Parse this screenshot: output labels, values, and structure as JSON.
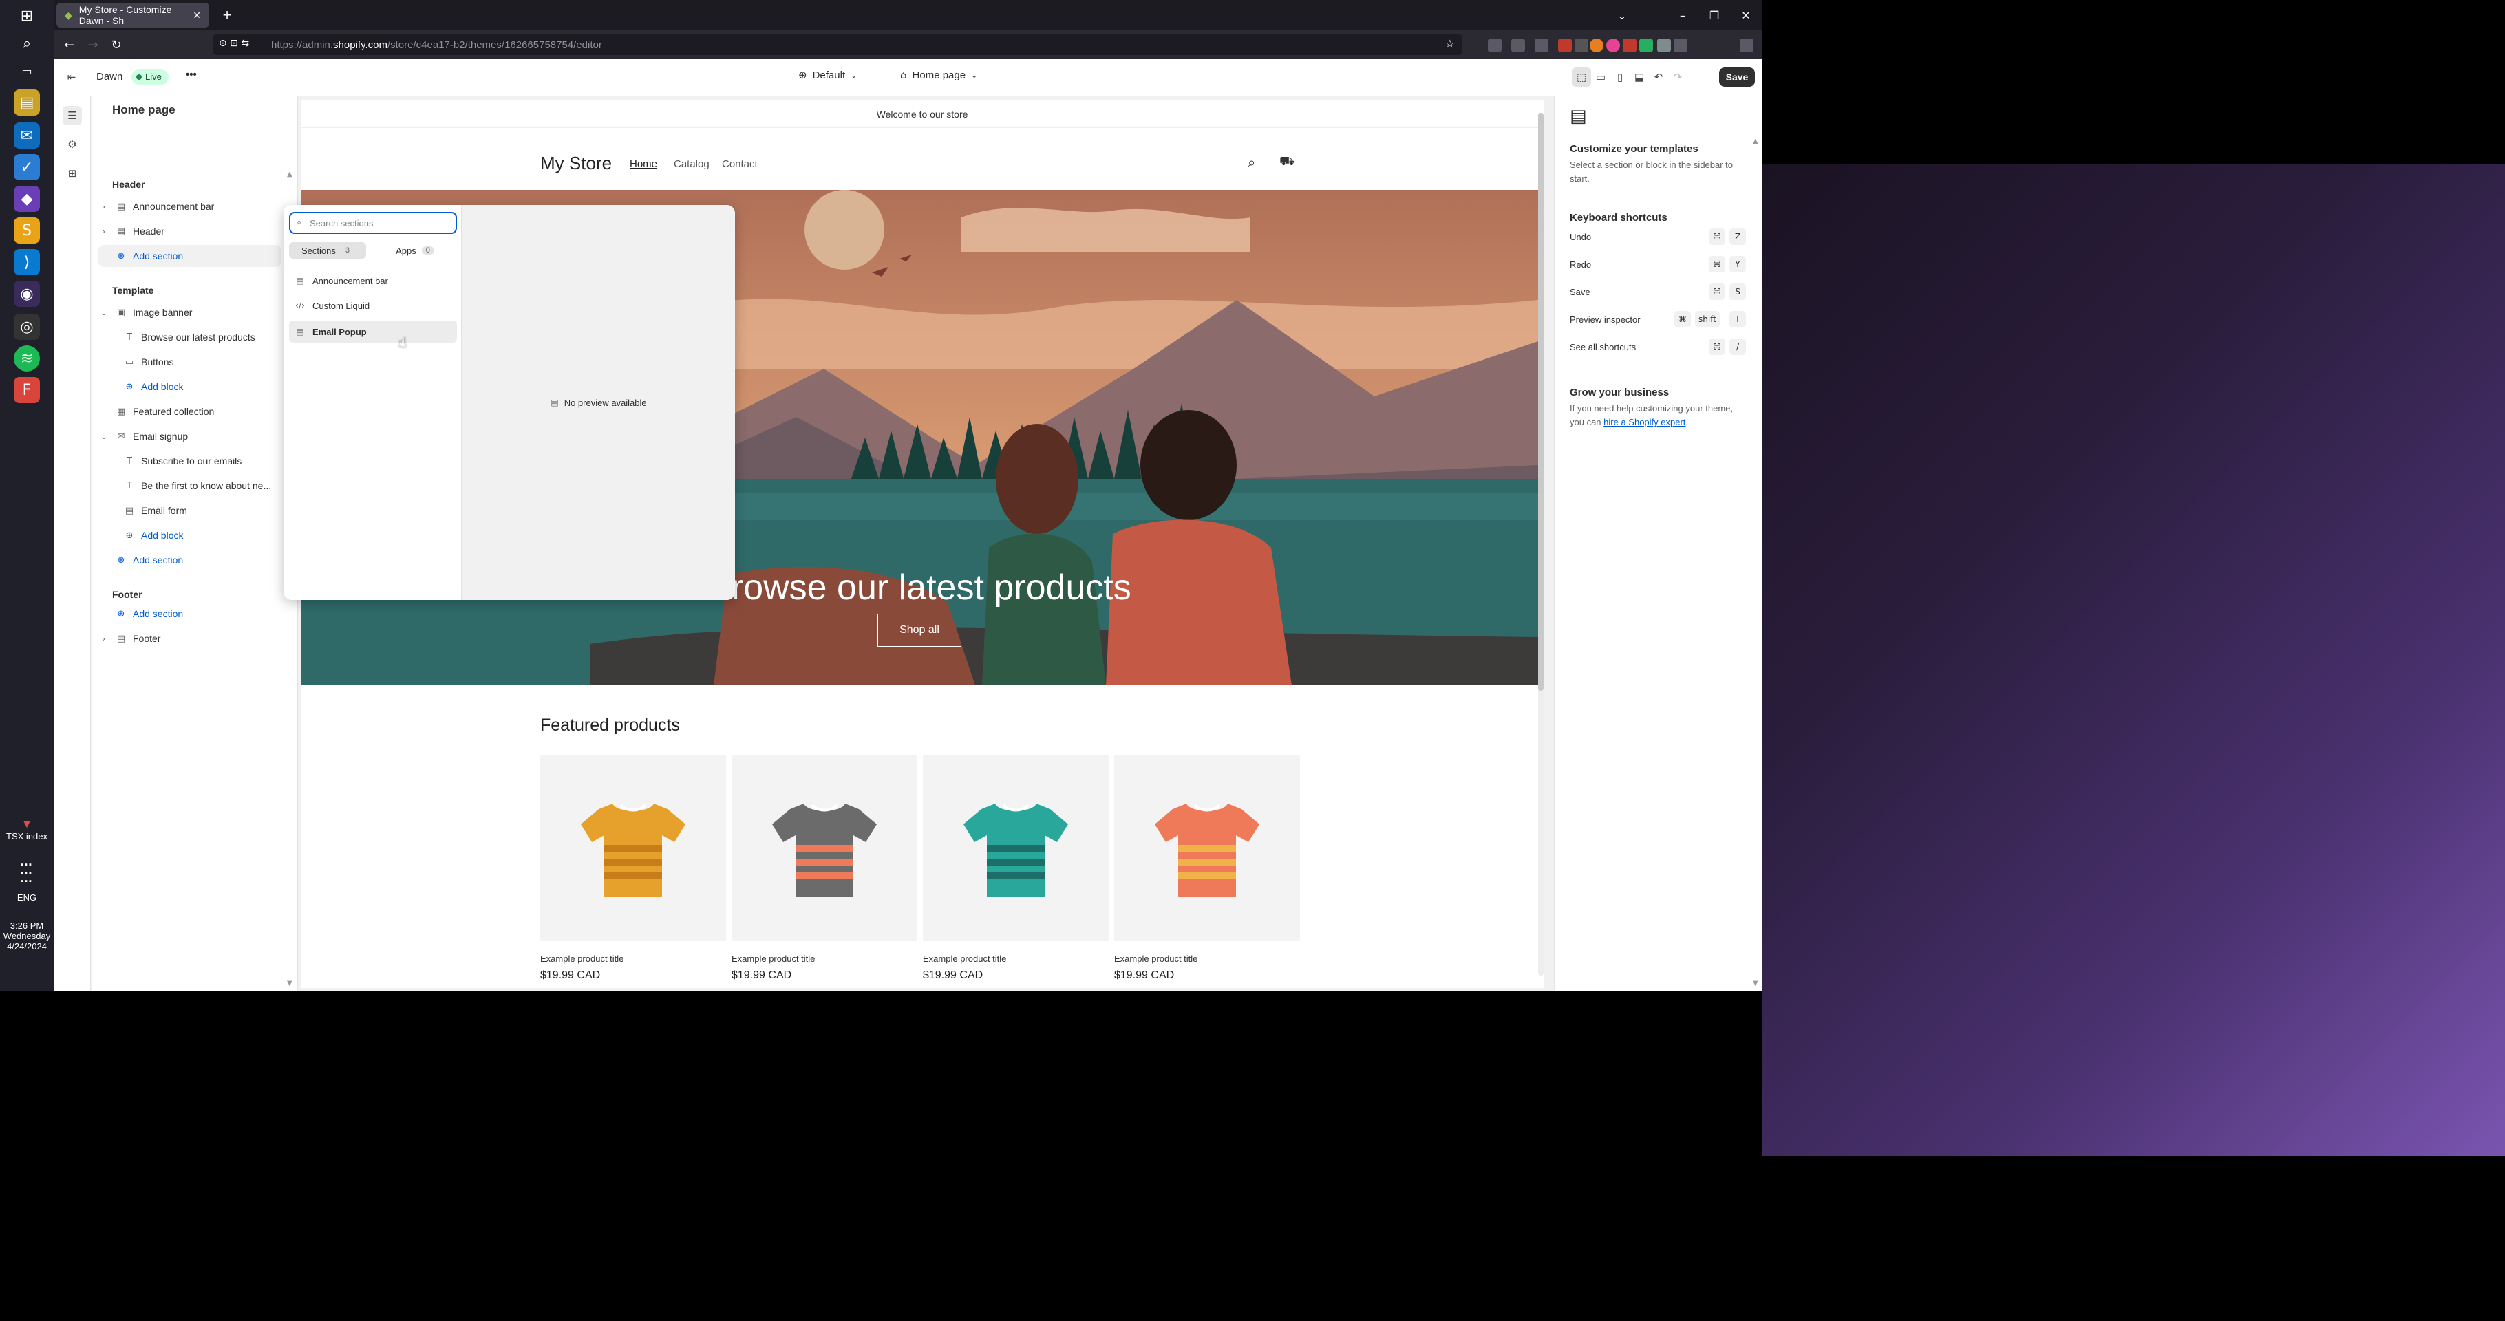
{
  "browser": {
    "tab_title": "My Store - Customize Dawn - Sh",
    "url_prefix": "https://admin.",
    "url_domain": "shopify.com",
    "url_path": "/store/c4ea17-b2/themes/162665758754/editor"
  },
  "taskbar": {
    "widget_label": "TSX index",
    "lang": "ENG",
    "time": "3:26 PM",
    "day": "Wednesday",
    "date": "4/24/2024"
  },
  "topbar": {
    "theme_name": "Dawn",
    "live_badge": "Live",
    "more_label": "•••",
    "default_dropdown": "Default",
    "page_dropdown": "Home page",
    "save_label": "Save"
  },
  "sidebar": {
    "title": "Home page",
    "header_group": "Header",
    "header_items": [
      "Announcement bar",
      "Header"
    ],
    "add_section": "Add section",
    "template_group": "Template",
    "image_banner": "Image banner",
    "image_banner_children": [
      "Browse our latest products",
      "Buttons"
    ],
    "add_block": "Add block",
    "featured_collection": "Featured collection",
    "email_signup": "Email signup",
    "email_children": [
      "Subscribe to our emails",
      "Be the first to know about ne...",
      "Email form"
    ],
    "footer_group": "Footer",
    "footer_item": "Footer"
  },
  "picker": {
    "search_placeholder": "Search sections",
    "tab_sections": "Sections",
    "tab_sections_count": "3",
    "tab_apps": "Apps",
    "tab_apps_count": "0",
    "items": [
      "Announcement bar",
      "Custom Liquid",
      "Email Popup"
    ],
    "no_preview": "No preview available"
  },
  "store": {
    "announcement": "Welcome to our store",
    "name": "My Store",
    "nav": [
      "Home",
      "Catalog",
      "Contact"
    ],
    "hero_title": "Browse our latest products",
    "hero_button": "Shop all",
    "featured_title": "Featured products",
    "products": [
      {
        "title": "Example product title",
        "price": "$19.99 CAD",
        "color": "#e5a12b",
        "stripe": "#c97d18"
      },
      {
        "title": "Example product title",
        "price": "$19.99 CAD",
        "color": "#6b6b6b",
        "stripe": "#ef7a5a"
      },
      {
        "title": "Example product title",
        "price": "$19.99 CAD",
        "color": "#2aa79b",
        "stripe": "#1b6f68"
      },
      {
        "title": "Example product title",
        "price": "$19.99 CAD",
        "color": "#ef7a5a",
        "stripe": "#f2b24a"
      }
    ]
  },
  "right_panel": {
    "title": "Customize your templates",
    "subtitle": "Select a section or block in the sidebar to start.",
    "shortcuts_title": "Keyboard shortcuts",
    "shortcuts": [
      {
        "label": "Undo",
        "keys": [
          "⌘",
          "Z"
        ]
      },
      {
        "label": "Redo",
        "keys": [
          "⌘",
          "Y"
        ]
      },
      {
        "label": "Save",
        "keys": [
          "⌘",
          "S"
        ]
      },
      {
        "label": "Preview inspector",
        "keys": [
          "⌘",
          "shift",
          "I"
        ]
      },
      {
        "label": "See all shortcuts",
        "keys": [
          "⌘",
          "/"
        ]
      }
    ],
    "grow_title": "Grow your business",
    "grow_text_1": "If you need help customizing your theme, you can",
    "grow_link": "hire a Shopify expert",
    "grow_text_2": "."
  },
  "colors": {
    "accent_blue": "#005bd3",
    "live_green": "#29845a",
    "save_dark": "#303030"
  }
}
